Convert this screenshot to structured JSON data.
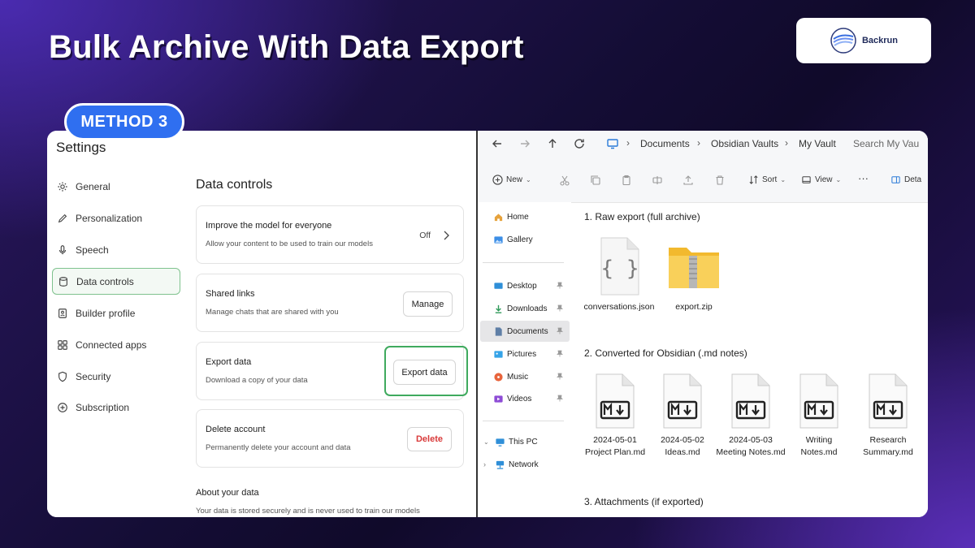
{
  "header": {
    "title": "Bulk Archive With Data Export",
    "brand": "Backrun",
    "method_badge": "METHOD 3"
  },
  "settings": {
    "title": "Settings",
    "nav": [
      {
        "label": "General",
        "icon": "gear-icon"
      },
      {
        "label": "Personalization",
        "icon": "pen-icon"
      },
      {
        "label": "Speech",
        "icon": "microphone-icon"
      },
      {
        "label": "Data controls",
        "icon": "database-icon",
        "active": true
      },
      {
        "label": "Builder profile",
        "icon": "id-card-icon"
      },
      {
        "label": "Connected apps",
        "icon": "grid-icon"
      },
      {
        "label": "Security",
        "icon": "shield-icon"
      },
      {
        "label": "Subscription",
        "icon": "plus-circle-icon"
      }
    ],
    "section_title": "Data controls",
    "cards": {
      "improve": {
        "title": "Improve the model for everyone",
        "desc": "Allow your content to be used to train our models",
        "value": "Off"
      },
      "shared": {
        "title": "Shared links",
        "desc": "Manage chats that are shared with you",
        "button": "Manage"
      },
      "export": {
        "title": "Export data",
        "desc": "Download a copy of your data",
        "button": "Export data"
      },
      "delete": {
        "title": "Delete account",
        "desc": "Permanently delete your account and data",
        "button": "Delete"
      }
    },
    "about_title": "About your data",
    "about_text": "Your data is stored securely and is never used to train our models"
  },
  "explorer": {
    "breadcrumb": [
      "Documents",
      "Obsidian Vaults",
      "My Vault"
    ],
    "search_placeholder": "Search My Vau",
    "toolbar": {
      "new": "New",
      "sort": "Sort",
      "view": "View",
      "details": "Deta"
    },
    "nav": [
      {
        "label": "Home",
        "icon": "home-icon"
      },
      {
        "label": "Gallery",
        "icon": "gallery-icon"
      },
      {
        "label": "Desktop",
        "icon": "desktop-icon",
        "pinned": true
      },
      {
        "label": "Downloads",
        "icon": "download-icon",
        "pinned": true
      },
      {
        "label": "Documents",
        "icon": "documents-icon",
        "pinned": true,
        "active": true
      },
      {
        "label": "Pictures",
        "icon": "pictures-icon",
        "pinned": true
      },
      {
        "label": "Music",
        "icon": "music-icon",
        "pinned": true
      },
      {
        "label": "Videos",
        "icon": "videos-icon",
        "pinned": true
      },
      {
        "label": "This PC",
        "icon": "pc-icon"
      },
      {
        "label": "Network",
        "icon": "network-icon"
      }
    ],
    "groups": [
      {
        "title": "1. Raw export (full archive)",
        "files": [
          {
            "name": "conversations.json",
            "icon": "json-file-icon"
          },
          {
            "name": "export.zip",
            "icon": "zip-folder-icon"
          }
        ]
      },
      {
        "title": "2. Converted for Obsidian (.md notes)",
        "files": [
          {
            "line1": "2024-05-01",
            "line2": "Project Plan.md",
            "icon": "markdown-file-icon"
          },
          {
            "line1": "2024-05-02",
            "line2": "Ideas.md",
            "icon": "markdown-file-icon"
          },
          {
            "line1": "2024-05-03",
            "line2": "Meeting Notes.md",
            "icon": "markdown-file-icon"
          },
          {
            "line1": "Writing",
            "line2": "Notes.md",
            "icon": "markdown-file-icon"
          },
          {
            "line1": "Research",
            "line2": "Summary.md",
            "icon": "markdown-file-icon"
          }
        ]
      },
      {
        "title": "3. Attachments (if exported)",
        "files": []
      }
    ]
  },
  "colors": {
    "accent_blue": "#2f6ff0",
    "highlight_green": "#3faa5e",
    "delete_red": "#d93a3a"
  }
}
